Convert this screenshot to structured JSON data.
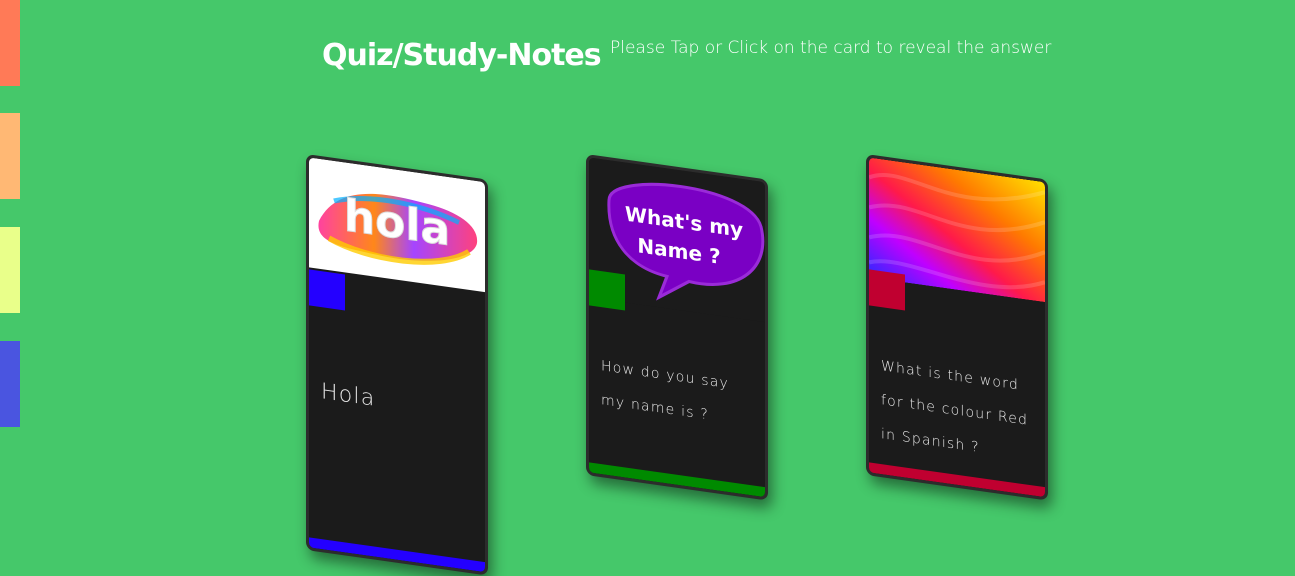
{
  "header": {
    "title": "Quiz/Study-Notes",
    "subtitle": "Please Tap or Click on the card to reveal the answer"
  },
  "side_tabs": [
    {
      "color": "#ff7a57"
    },
    {
      "color": "#ffb874"
    },
    {
      "color": "#e9ff8a"
    },
    {
      "color": "#4a55e0"
    }
  ],
  "cards": [
    {
      "image_text": "hola",
      "text": "Hola",
      "accent": "#2400ff"
    },
    {
      "image_text_1": "What's my",
      "image_text_2": "Name ?",
      "text": "How do you say my name is ?",
      "accent": "#008a00"
    },
    {
      "text": "What is the word for the colour Red in Spanish ?",
      "accent": "#c00030"
    }
  ]
}
